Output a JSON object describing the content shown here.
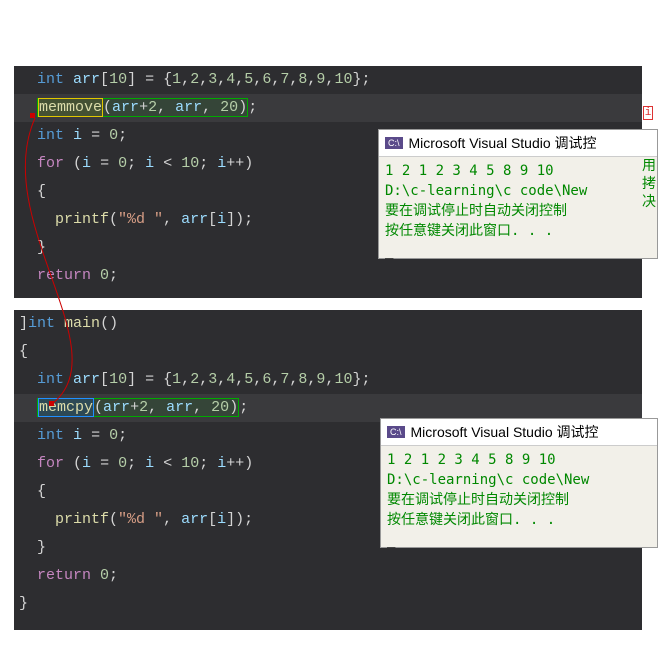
{
  "code_top": {
    "line1": "int arr[10] = {1,2,3,4,5,6,7,8,9,10};",
    "fn_name": "memmove",
    "fn_args": "(arr+2, arr, 20);",
    "line3": "int i = 0;",
    "for_line": "for (i = 0; i < 10; i++)",
    "printf_line": "printf(\"%d \", arr[i]);",
    "return_line": "return 0;"
  },
  "code_bottom": {
    "fn_decl": "int main()",
    "arr_line": "int arr[10] = {1,2,3,4,5,6,7,8,9,10};",
    "fn_name": "memcpy",
    "fn_args": "(arr+2, arr, 20);",
    "line_i": "int i = 0;",
    "for_line": "for (i = 0; i < 10; i++)",
    "printf_line": "printf(\"%d \", arr[i]);",
    "return_line": "return 0;"
  },
  "output1": {
    "title": "Microsoft Visual Studio 调试控",
    "icon_text": "C:\\",
    "line1": "1 2 1 2 3 4 5 8 9 10",
    "line2": "D:\\c-learning\\c code\\New",
    "line3": "要在调试停止时自动关闭控制",
    "line4": "按任意键关闭此窗口. . ."
  },
  "output2": {
    "title": "Microsoft Visual Studio 调试控",
    "icon_text": "C:\\",
    "line1": "1 2 1 2 3 4 5 8 9 10",
    "line2": "D:\\c-learning\\c code\\New ",
    "line3": " 要在调试停止时自动关闭控制",
    "line4": " 按任意键关闭此窗口. . ."
  },
  "annotations": {
    "red_i": "i",
    "green_text": "用\n拷\n决"
  },
  "chart_data": null
}
